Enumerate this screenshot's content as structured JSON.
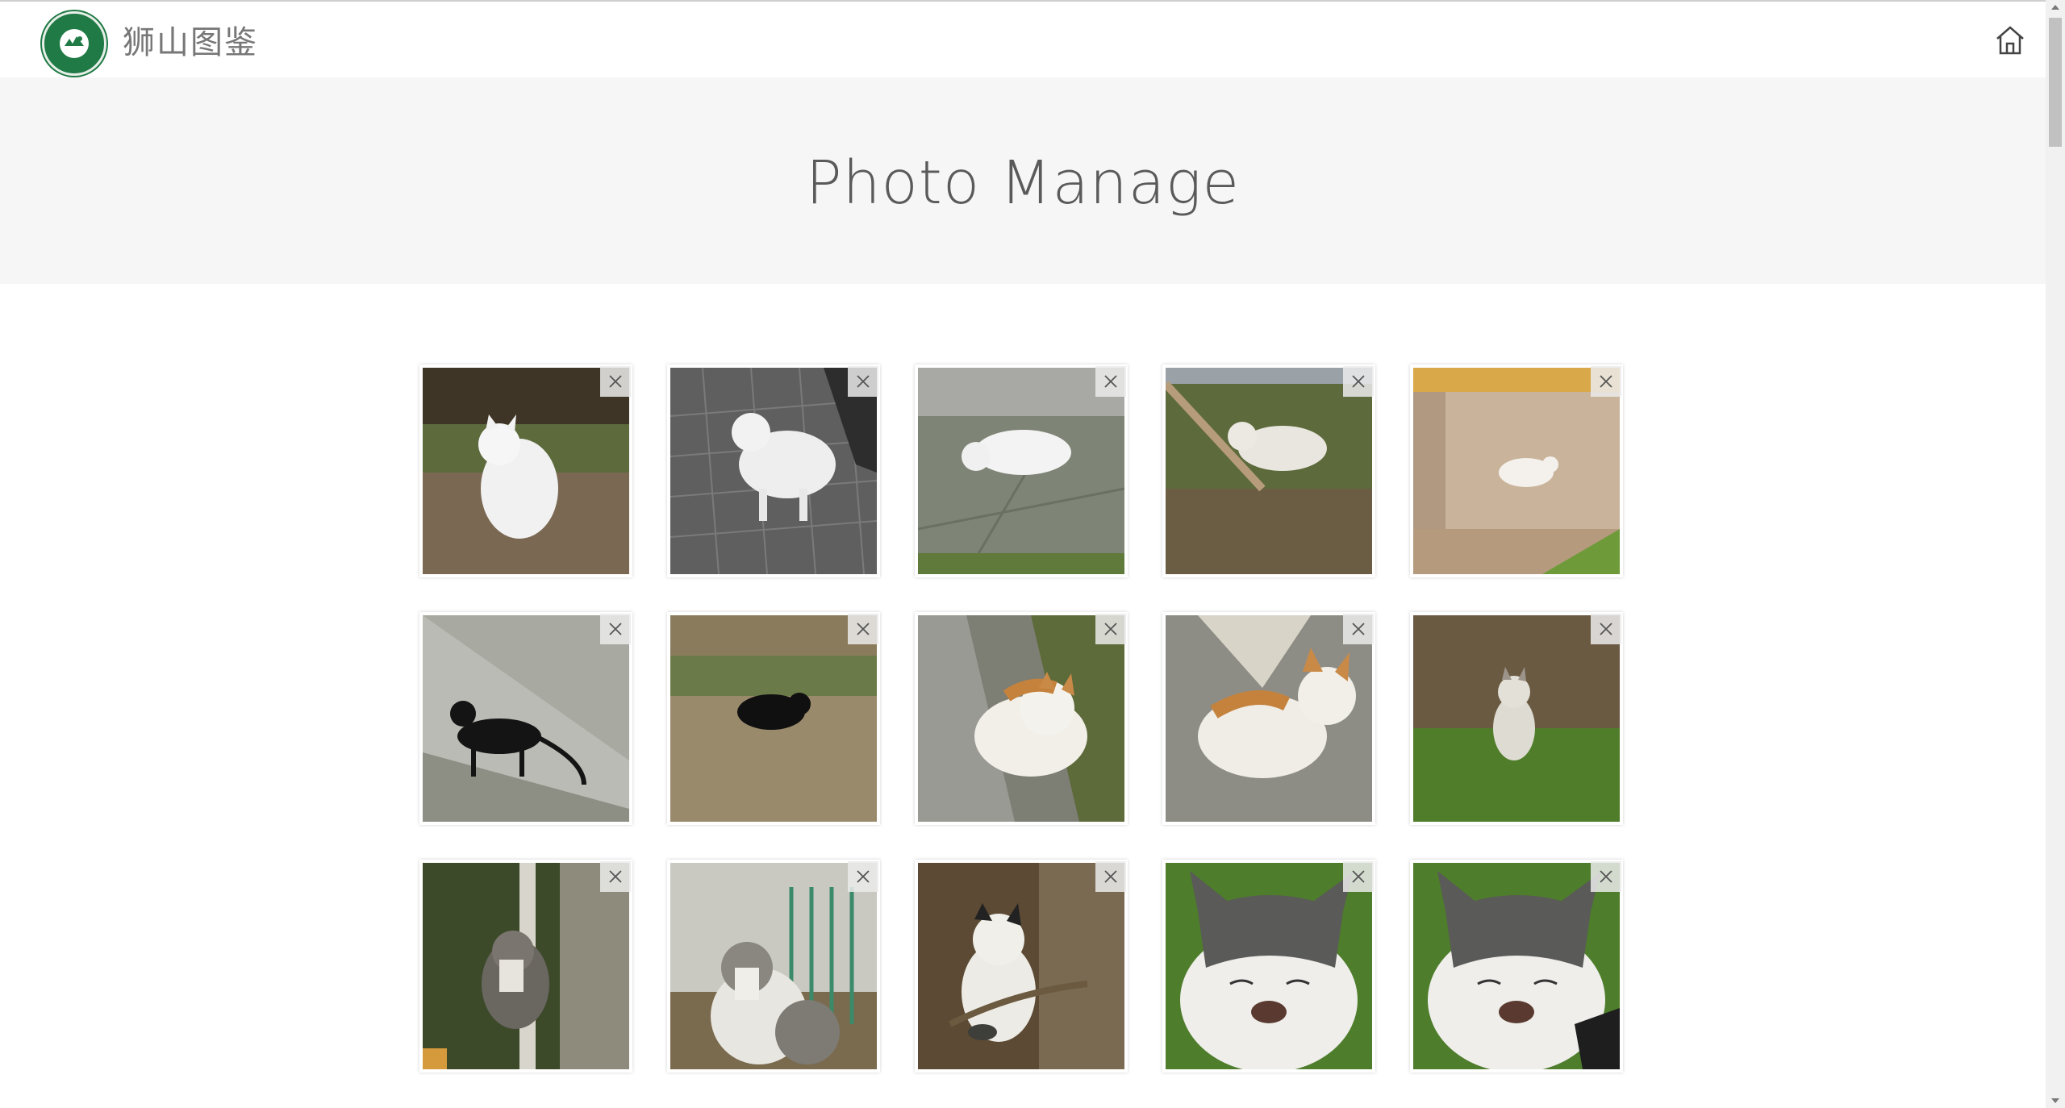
{
  "header": {
    "brand": "狮山图鉴",
    "logo_icon": "lion-mountain-logo",
    "home_icon": "home-icon"
  },
  "hero": {
    "title": "Photo Manage"
  },
  "colors": {
    "logo_green": "#1f7a45",
    "hero_bg": "#f6f6f6",
    "title_text": "#5a5a5a"
  },
  "photos": [
    {
      "scene": "white cat sitting on leaves"
    },
    {
      "scene": "white cat standing on paving"
    },
    {
      "scene": "white cat lying on stone"
    },
    {
      "scene": "white cat in grass"
    },
    {
      "scene": "white cat by wall"
    },
    {
      "scene": "black cat walking on ledge"
    },
    {
      "scene": "black cat on ground"
    },
    {
      "scene": "orange-white cat lying by curb"
    },
    {
      "scene": "orange-white cat lying"
    },
    {
      "scene": "grey-white cat in grass"
    },
    {
      "scene": "tabby cat by fence"
    },
    {
      "scene": "tabby-white cat sitting"
    },
    {
      "scene": "white-black cat by tree"
    },
    {
      "scene": "grey-white cat close-up"
    },
    {
      "scene": "grey-white cat close-up"
    }
  ]
}
